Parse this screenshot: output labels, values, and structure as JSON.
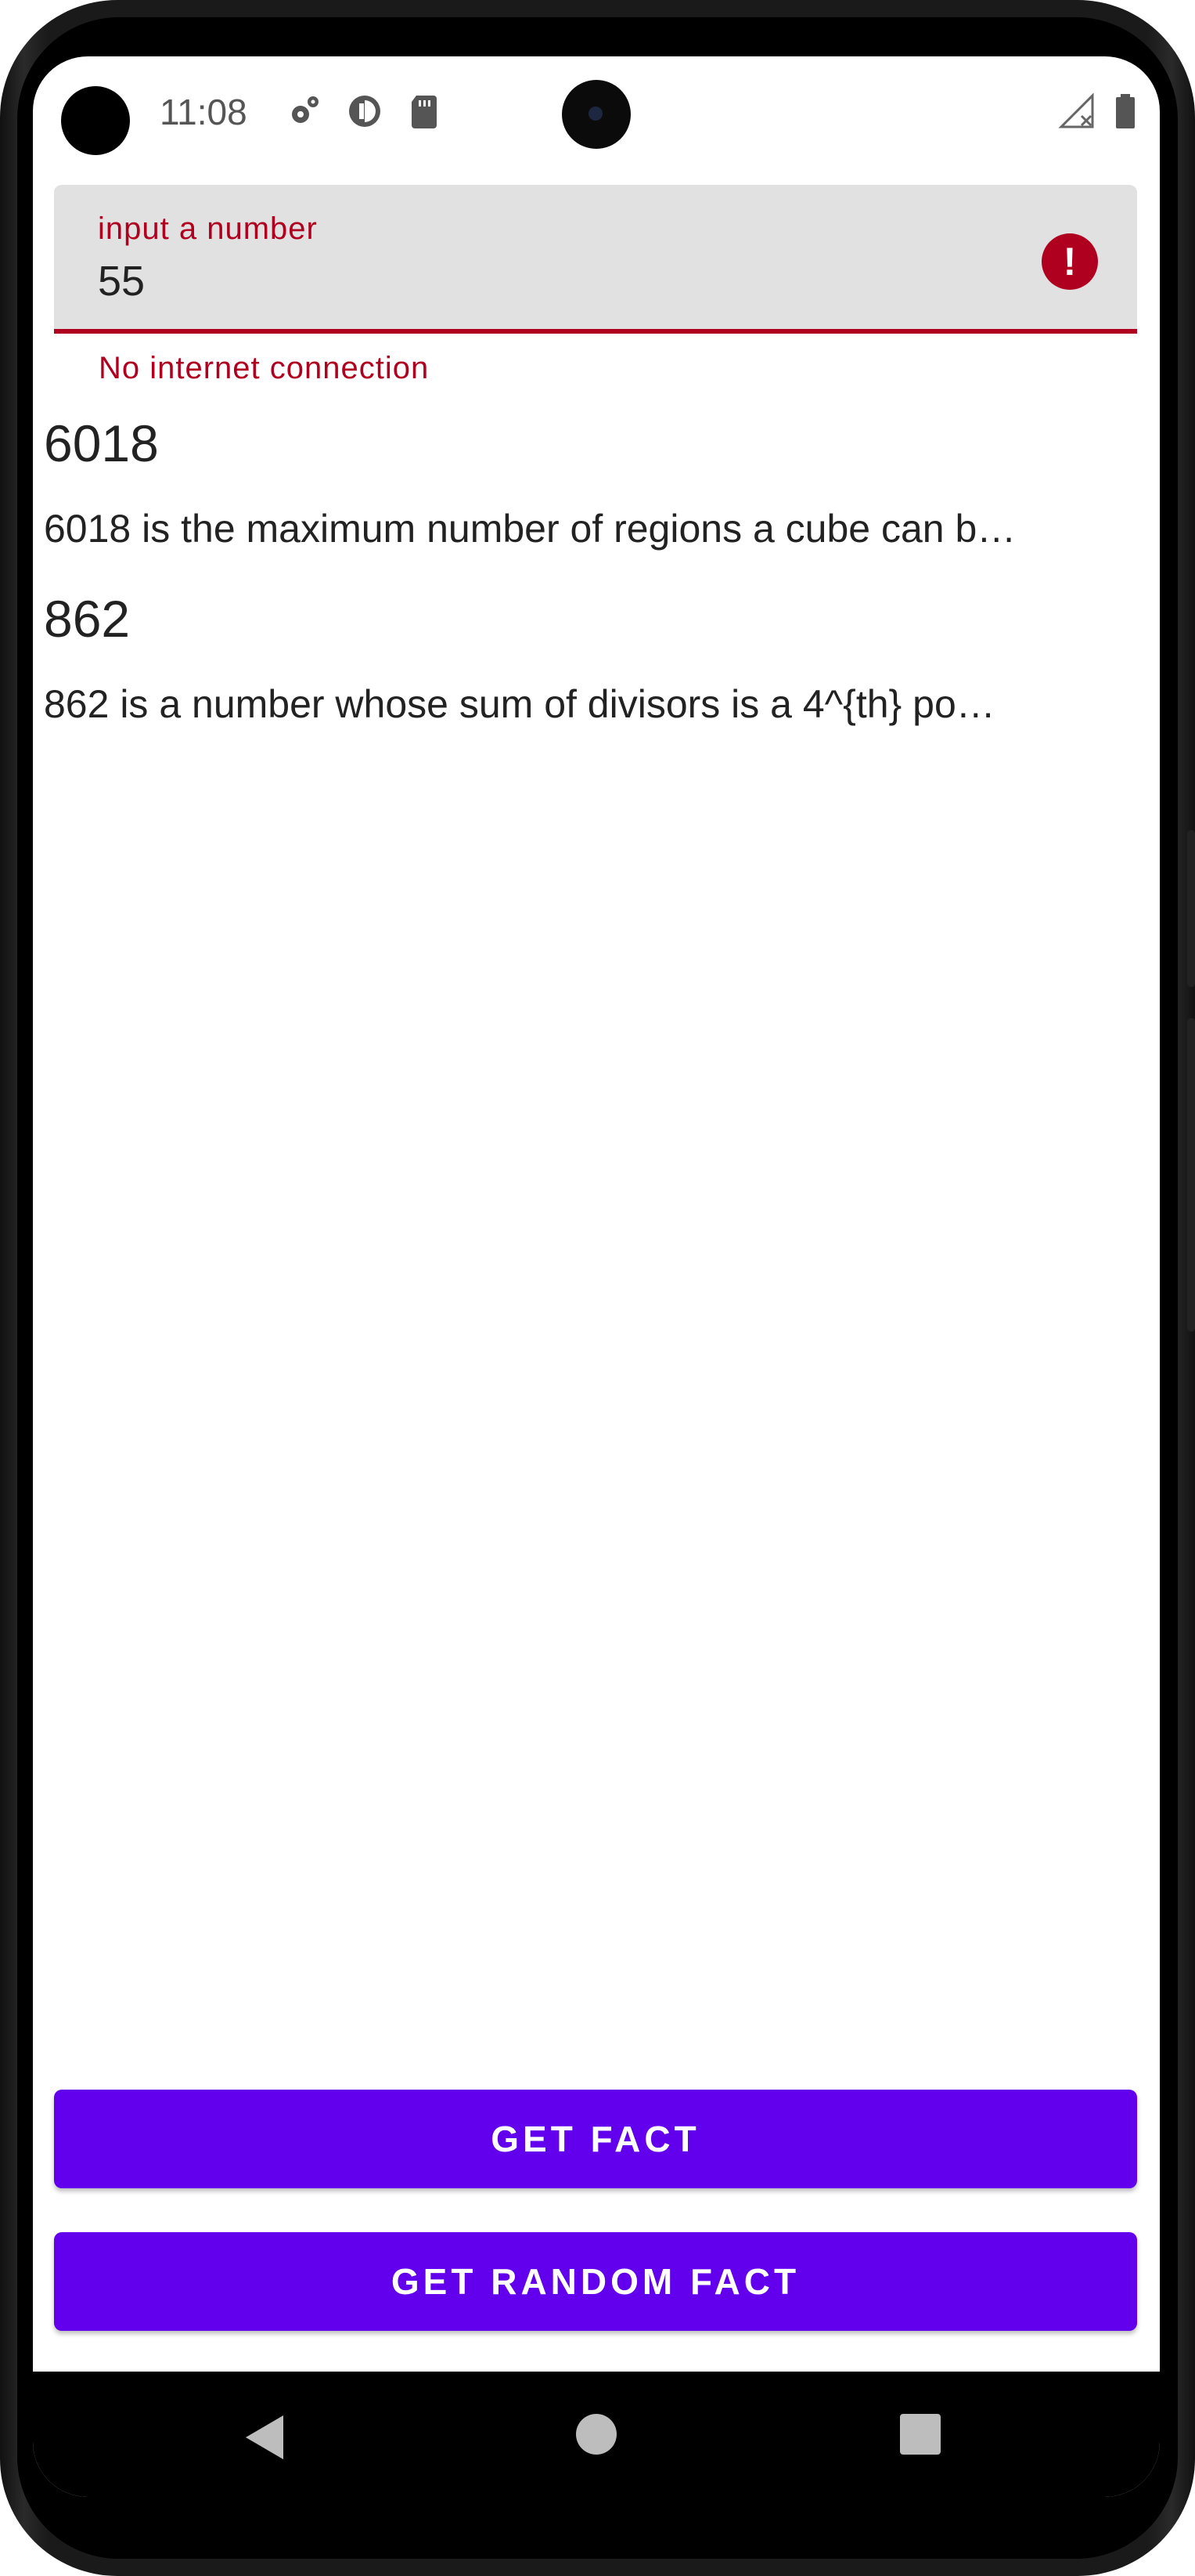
{
  "status_bar": {
    "time": "11:08",
    "icons": [
      "settings-gear-icon",
      "data-saver-icon",
      "sd-card-icon",
      "signal-off-icon",
      "battery-icon"
    ]
  },
  "input": {
    "label": "input a number",
    "value": "55",
    "error": "No internet connection",
    "error_color": "#b00020"
  },
  "facts": [
    {
      "title": "6018",
      "text": "6018 is the maximum number of regions a cube can b…"
    },
    {
      "title": "862",
      "text": "862 is a number whose sum of divisors is a 4^{th} po…"
    }
  ],
  "buttons": {
    "get_fact": "GET FACT",
    "get_random_fact": "GET RANDOM FACT",
    "color": "#6200ee"
  },
  "nav": [
    "back-icon",
    "home-icon",
    "recents-icon"
  ]
}
